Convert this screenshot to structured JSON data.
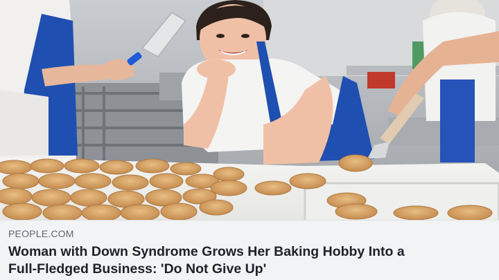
{
  "link_preview": {
    "source_domain": "PEOPLE.COM",
    "headline_line1": "Woman with Down Syndrome Grows Her Baking Hobby Into a",
    "headline_line2": "Full-Fledged Business: 'Do Not Give Up'"
  },
  "colors": {
    "caption_background": "#f2f3f5",
    "domain_text": "#606770",
    "headline_text": "#1d2129",
    "apron_blue": "#1f4fb0",
    "cookie": "#d8a66a"
  }
}
